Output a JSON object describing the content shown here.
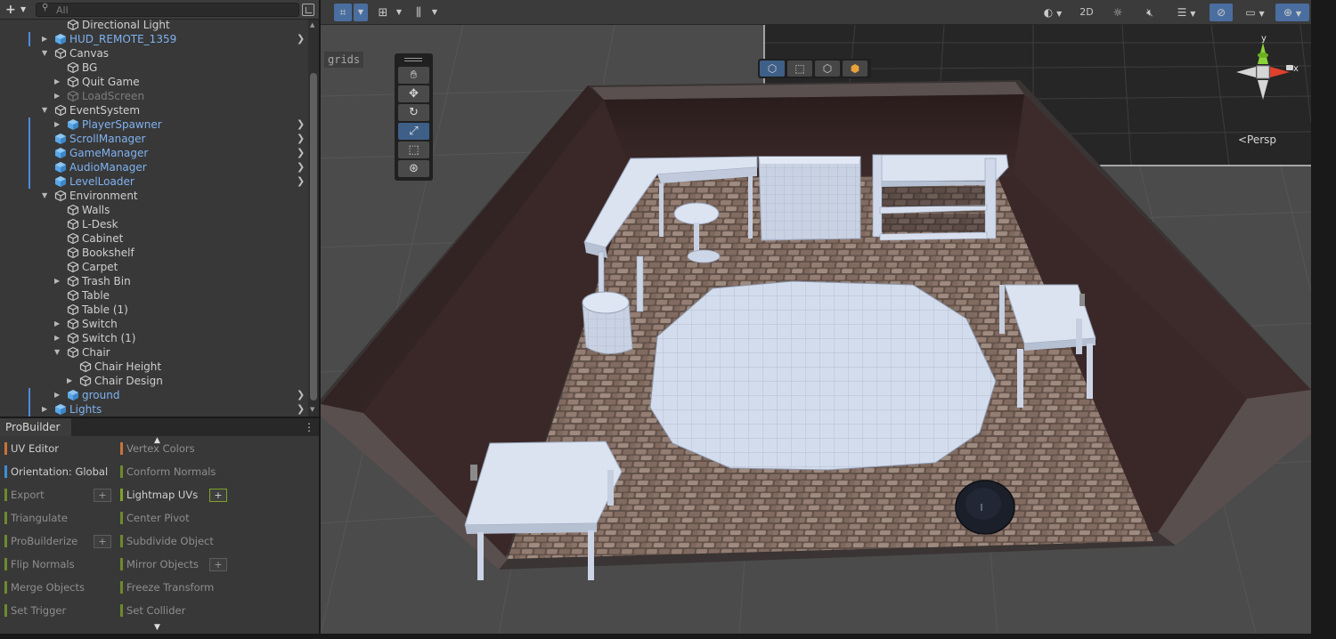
{
  "hierarchy": {
    "add_label": "+",
    "search_placeholder": "All",
    "rows": [
      {
        "label": "Directional Light",
        "depth": 1,
        "fold": "",
        "kind": "object",
        "mark": false,
        "more": false
      },
      {
        "label": "HUD_REMOTE_1359",
        "depth": 0,
        "fold": "closed",
        "kind": "prefab",
        "mark": true,
        "more": true
      },
      {
        "label": "Canvas",
        "depth": 0,
        "fold": "open",
        "kind": "object",
        "mark": false,
        "more": false
      },
      {
        "label": "BG",
        "depth": 1,
        "fold": "",
        "kind": "object",
        "mark": false,
        "more": false
      },
      {
        "label": "Quit Game",
        "depth": 1,
        "fold": "closed",
        "kind": "object",
        "mark": false,
        "more": false
      },
      {
        "label": "LoadScreen",
        "depth": 1,
        "fold": "closed",
        "kind": "inactive",
        "mark": false,
        "more": false
      },
      {
        "label": "EventSystem",
        "depth": 0,
        "fold": "open",
        "kind": "object",
        "mark": false,
        "more": false
      },
      {
        "label": "PlayerSpawner",
        "depth": 1,
        "fold": "closed",
        "kind": "prefab",
        "mark": true,
        "more": true
      },
      {
        "label": "ScrollManager",
        "depth": 0,
        "fold": "",
        "kind": "prefab",
        "mark": true,
        "more": true
      },
      {
        "label": "GameManager",
        "depth": 0,
        "fold": "",
        "kind": "prefab",
        "mark": true,
        "more": true
      },
      {
        "label": "AudioManager",
        "depth": 0,
        "fold": "",
        "kind": "prefab",
        "mark": true,
        "more": true
      },
      {
        "label": "LevelLoader",
        "depth": 0,
        "fold": "",
        "kind": "prefab",
        "mark": true,
        "more": true
      },
      {
        "label": "Environment",
        "depth": 0,
        "fold": "open",
        "kind": "object",
        "mark": false,
        "more": false
      },
      {
        "label": "Walls",
        "depth": 1,
        "fold": "",
        "kind": "object",
        "mark": false,
        "more": false
      },
      {
        "label": "L-Desk",
        "depth": 1,
        "fold": "",
        "kind": "object",
        "mark": false,
        "more": false
      },
      {
        "label": "Cabinet",
        "depth": 1,
        "fold": "",
        "kind": "object",
        "mark": false,
        "more": false
      },
      {
        "label": "Bookshelf",
        "depth": 1,
        "fold": "",
        "kind": "object",
        "mark": false,
        "more": false
      },
      {
        "label": "Carpet",
        "depth": 1,
        "fold": "",
        "kind": "object",
        "mark": false,
        "more": false
      },
      {
        "label": "Trash Bin",
        "depth": 1,
        "fold": "closed",
        "kind": "object",
        "mark": false,
        "more": false
      },
      {
        "label": "Table",
        "depth": 1,
        "fold": "",
        "kind": "object",
        "mark": false,
        "more": false
      },
      {
        "label": "Table (1)",
        "depth": 1,
        "fold": "",
        "kind": "object",
        "mark": false,
        "more": false
      },
      {
        "label": "Switch",
        "depth": 1,
        "fold": "closed",
        "kind": "object",
        "mark": false,
        "more": false
      },
      {
        "label": "Switch (1)",
        "depth": 1,
        "fold": "closed",
        "kind": "object",
        "mark": false,
        "more": false
      },
      {
        "label": "Chair",
        "depth": 1,
        "fold": "open",
        "kind": "object",
        "mark": false,
        "more": false
      },
      {
        "label": "Chair Height",
        "depth": 2,
        "fold": "",
        "kind": "object",
        "mark": false,
        "more": false
      },
      {
        "label": "Chair Design",
        "depth": 2,
        "fold": "closed",
        "kind": "object",
        "mark": false,
        "more": false
      },
      {
        "label": "ground",
        "depth": 1,
        "fold": "closed",
        "kind": "prefab",
        "mark": true,
        "more": true
      },
      {
        "label": "Lights",
        "depth": 0,
        "fold": "closed",
        "kind": "prefab",
        "mark": true,
        "more": true
      }
    ]
  },
  "probuilder": {
    "tab_label": "ProBuilder",
    "menu_glyph": "⋮",
    "buttons": [
      {
        "label": "UV Editor",
        "col": 0,
        "row": 0,
        "color": "#c8733a",
        "active": true,
        "plus": false,
        "plus_lit": false
      },
      {
        "label": "Vertex Colors",
        "col": 1,
        "row": 0,
        "color": "#c8733a",
        "active": false,
        "plus": false,
        "plus_lit": false
      },
      {
        "label": "Orientation: Global",
        "col": 0,
        "row": 1,
        "color": "#3d8ed8",
        "active": true,
        "plus": false,
        "plus_lit": false
      },
      {
        "label": "Conform Normals",
        "col": 1,
        "row": 1,
        "color": "#6d8a2a",
        "active": false,
        "plus": false,
        "plus_lit": false
      },
      {
        "label": "Export",
        "col": 0,
        "row": 2,
        "color": "#6d8a2a",
        "active": false,
        "plus": true,
        "plus_lit": false
      },
      {
        "label": "Lightmap UVs",
        "col": 1,
        "row": 2,
        "color": "#7fa32a",
        "active": true,
        "plus": true,
        "plus_lit": true
      },
      {
        "label": "Triangulate",
        "col": 0,
        "row": 3,
        "color": "#6d8a2a",
        "active": false,
        "plus": false,
        "plus_lit": false
      },
      {
        "label": "Center Pivot",
        "col": 1,
        "row": 3,
        "color": "#6d8a2a",
        "active": false,
        "plus": false,
        "plus_lit": false
      },
      {
        "label": "ProBuilderize",
        "col": 0,
        "row": 4,
        "color": "#6d8a2a",
        "active": false,
        "plus": true,
        "plus_lit": false
      },
      {
        "label": "Subdivide Object",
        "col": 1,
        "row": 4,
        "color": "#6d8a2a",
        "active": false,
        "plus": false,
        "plus_lit": false
      },
      {
        "label": "Flip Normals",
        "col": 0,
        "row": 5,
        "color": "#6d8a2a",
        "active": false,
        "plus": false,
        "plus_lit": false
      },
      {
        "label": "Mirror Objects",
        "col": 1,
        "row": 5,
        "color": "#6d8a2a",
        "active": false,
        "plus": true,
        "plus_lit": false
      },
      {
        "label": "Merge Objects",
        "col": 0,
        "row": 6,
        "color": "#6d8a2a",
        "active": false,
        "plus": false,
        "plus_lit": false
      },
      {
        "label": "Freeze Transform",
        "col": 1,
        "row": 6,
        "color": "#6d8a2a",
        "active": false,
        "plus": false,
        "plus_lit": false
      },
      {
        "label": "Set Trigger",
        "col": 0,
        "row": 7,
        "color": "#6d8a2a",
        "active": false,
        "plus": false,
        "plus_lit": false
      },
      {
        "label": "Set Collider",
        "col": 1,
        "row": 7,
        "color": "#6d8a2a",
        "active": false,
        "plus": false,
        "plus_lit": false
      }
    ]
  },
  "scene": {
    "grids_label": "grids",
    "toggle_2d_label": "2D",
    "persp_label": "<Persp",
    "axis_x": "x",
    "axis_y": "y"
  },
  "colors": {
    "selected": "#4a6ea0",
    "prefab_text": "#7fb2f0",
    "prefab_icon": "#5aa7e8",
    "gizmo_x": "#e0412c",
    "gizmo_y": "#8ad23a",
    "gizmo_z": "#3f7fe0",
    "object_white": "#d3dcec"
  }
}
